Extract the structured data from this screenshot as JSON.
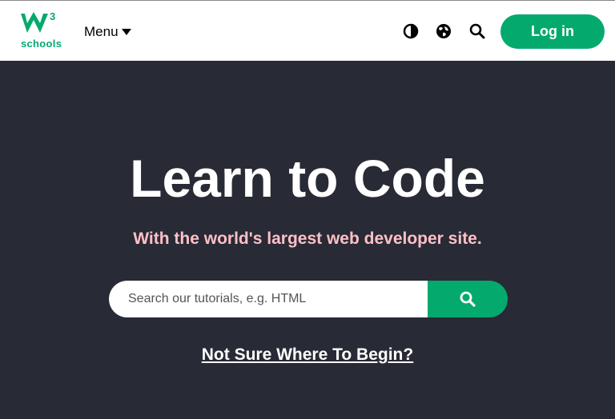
{
  "header": {
    "logo_text": "schools",
    "logo_superscript": "3",
    "menu_label": "Menu",
    "login_label": "Log in",
    "icons": [
      "contrast-icon",
      "globe-icon",
      "search-icon"
    ]
  },
  "hero": {
    "title": "Learn to Code",
    "subtitle": "With the world's largest web developer site.",
    "search_placeholder": "Search our tutorials, e.g. HTML",
    "begin_link": "Not Sure Where To Begin?"
  },
  "colors": {
    "brand_green": "#04aa6d",
    "hero_background": "#282a35",
    "subtitle_pink": "#ffc0c7"
  }
}
